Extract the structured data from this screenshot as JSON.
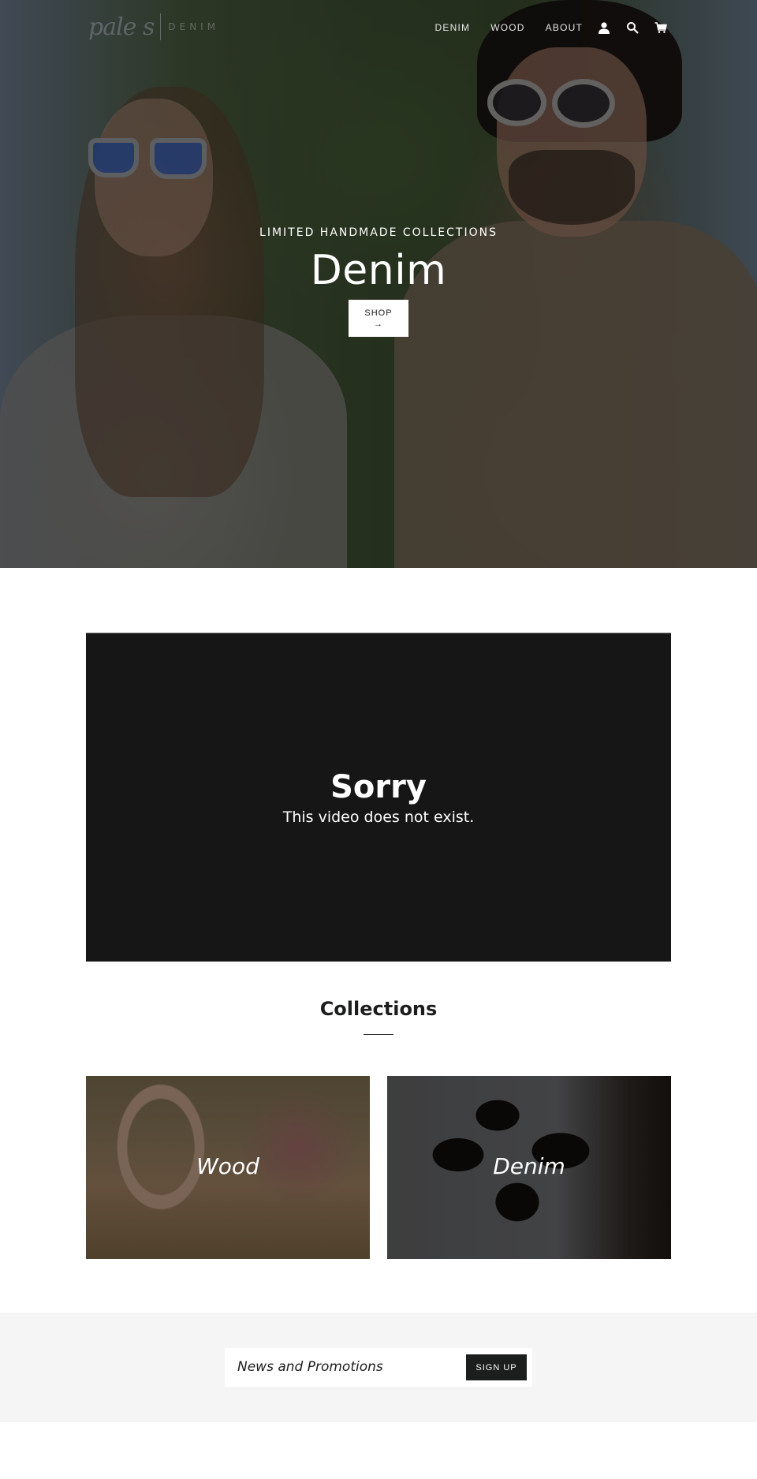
{
  "header": {
    "logo": {
      "script": "pale  s",
      "sub": "DENIM"
    },
    "nav": [
      {
        "label": "DENIM"
      },
      {
        "label": "WOOD"
      },
      {
        "label": "ABOUT"
      }
    ],
    "icons": [
      "account-icon",
      "search-icon",
      "cart-icon"
    ]
  },
  "hero": {
    "kicker": "LIMITED HANDMADE COLLECTIONS",
    "title": "Denim",
    "button_label": "SHOP",
    "button_arrow": "→"
  },
  "video": {
    "title": "Sorry",
    "message": "This video does not exist."
  },
  "collections": {
    "title": "Collections",
    "items": [
      {
        "label": "Wood"
      },
      {
        "label": "Denim"
      }
    ]
  },
  "newsletter": {
    "placeholder": "News and Promotions",
    "value": "",
    "button_label": "SIGN UP"
  },
  "colors": {
    "dark": "#1c1d1d",
    "video_bg": "#161616",
    "newsletter_bg": "#f5f5f5"
  }
}
